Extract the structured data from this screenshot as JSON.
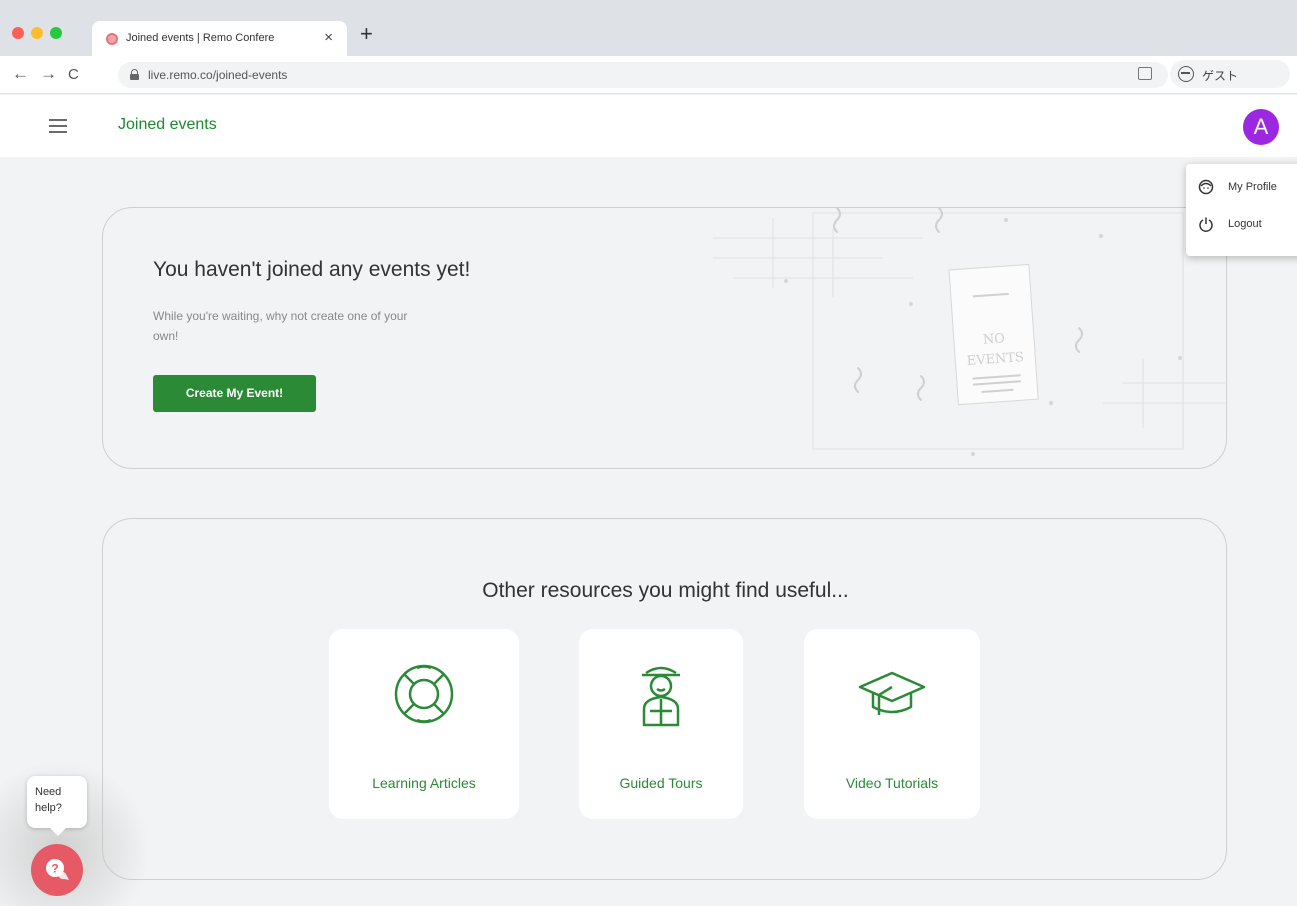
{
  "browser": {
    "tab_title": "Joined events | Remo Confere",
    "tab_close": "×",
    "new_tab": "+",
    "url": "live.remo.co/joined-events",
    "guest_label": "ゲスト",
    "nav": {
      "back": "←",
      "forward": "→",
      "reload": "C"
    }
  },
  "app": {
    "title": "Joined events",
    "avatar_letter": "A"
  },
  "menu": {
    "items": [
      {
        "label": "My Profile",
        "icon": "profile-icon"
      },
      {
        "label": "Logout",
        "icon": "power-icon"
      }
    ]
  },
  "empty_state": {
    "title": "You haven't joined any events yet!",
    "subtitle": "While you're waiting, why not create one of your own!",
    "button": "Create My Event!",
    "sign_line1": "NO",
    "sign_line2": "EVENTS"
  },
  "resources": {
    "heading": "Other resources you might find useful...",
    "cards": [
      {
        "label": "Learning Articles",
        "icon": "lifebuoy-icon"
      },
      {
        "label": "Guided Tours",
        "icon": "guide-icon"
      },
      {
        "label": "Video Tutorials",
        "icon": "graduation-cap-icon"
      }
    ]
  },
  "help": {
    "text": "Need help?"
  },
  "colors": {
    "brand_green": "#2b8a36",
    "avatar_purple": "#9b27e0",
    "help_red": "#e55a64"
  }
}
